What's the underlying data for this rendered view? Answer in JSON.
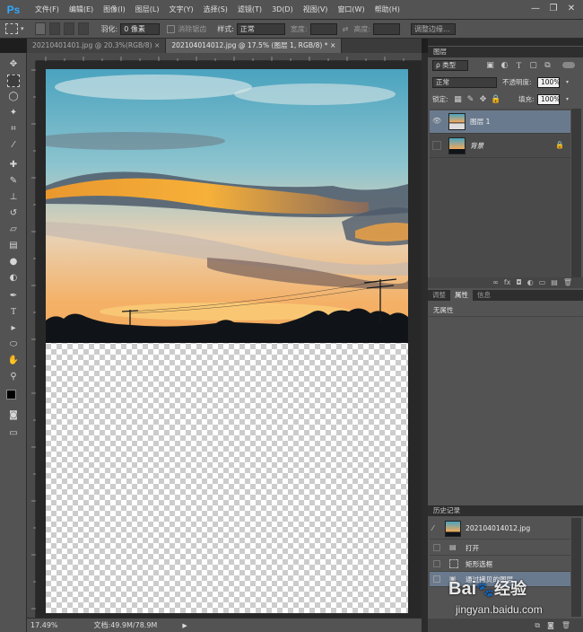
{
  "app": {
    "logo": "Ps"
  },
  "menu": [
    "文件(F)",
    "编辑(E)",
    "图像(I)",
    "图层(L)",
    "文字(Y)",
    "选择(S)",
    "滤镜(T)",
    "3D(D)",
    "视图(V)",
    "窗口(W)",
    "帮助(H)"
  ],
  "window_controls": {
    "minimize": "—",
    "restore": "❐",
    "close": "✕"
  },
  "options": {
    "feather_label": "羽化:",
    "feather_value": "0 像素",
    "antialias_label": "消除锯齿",
    "style_label": "样式:",
    "style_value": "正常",
    "width_label": "宽度:",
    "height_label": "高度:",
    "refine_button": "调整边缘..."
  },
  "tabs": [
    {
      "label": "20210401401.jpg @ 20.3%(RGB/8)",
      "close": "×",
      "active": false
    },
    {
      "label": "202104014012.jpg @ 17.5% (图层 1, RGB/8) *",
      "close": "×",
      "active": true
    }
  ],
  "status": {
    "zoom": "17.49%",
    "doc": "文档:49.9M/78.9M"
  },
  "layers_panel": {
    "title": "图层",
    "filter_label": "ρ 类型",
    "blend_mode": "正常",
    "opacity_label": "不透明度:",
    "opacity_value": "100%",
    "lock_label": "锁定:",
    "fill_label": "填充:",
    "fill_value": "100%",
    "layers": [
      {
        "name": "图层 1",
        "selected": true
      },
      {
        "name": "背景",
        "selected": false,
        "locked": true
      }
    ]
  },
  "props_panel": {
    "tabs": [
      "调整",
      "属性",
      "信息"
    ],
    "active_tab": "属性",
    "content": "无属性"
  },
  "history_panel": {
    "title": "历史记录",
    "snapshot": "202104014012.jpg",
    "items": [
      "打开",
      "矩形选框",
      "通过拷贝的图层"
    ]
  },
  "watermark": {
    "brand": "Bai",
    "brand2": "经验",
    "url": "jingyan.baidu.com"
  },
  "colors": {
    "ui": "#535353",
    "panel_dark": "#2e2e2e",
    "selected_layer": "#6a7a8e",
    "arrow": "#e8202a",
    "ps_blue": "#31a8ff"
  }
}
